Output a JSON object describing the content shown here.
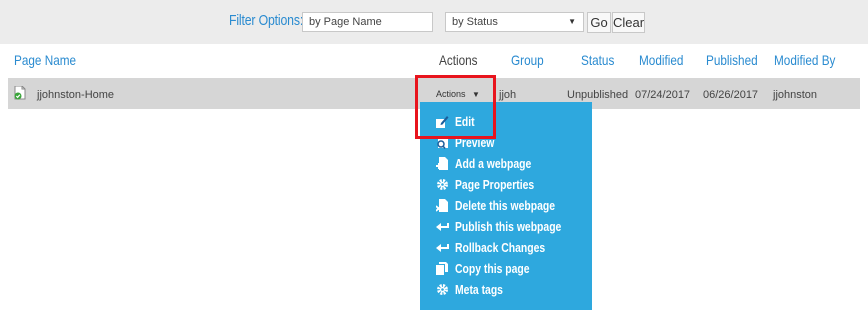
{
  "filter": {
    "label": "Filter Options:",
    "name_placeholder": "by Page Name",
    "status_select": "by Status",
    "go_label": "Go",
    "clear_label": "Clear"
  },
  "table": {
    "headers": {
      "page_name": "Page Name",
      "actions": "Actions",
      "group": "Group",
      "status": "Status",
      "modified": "Modified",
      "published": "Published",
      "modified_by": "Modified By"
    },
    "row": {
      "page_name": "jjohnston-Home",
      "actions": "Actions",
      "group": "jjoh",
      "status": "Unpublished",
      "modified": "07/24/2017",
      "published": "06/26/2017",
      "modified_by": "jjohnston"
    }
  },
  "menu": {
    "items": [
      {
        "label": "Edit",
        "icon": "edit-icon"
      },
      {
        "label": "Preview",
        "icon": "preview-icon"
      },
      {
        "label": "Add a webpage",
        "icon": "add-page-icon"
      },
      {
        "label": "Page Properties",
        "icon": "gear-icon"
      },
      {
        "label": "Delete this webpage",
        "icon": "delete-page-icon"
      },
      {
        "label": "Publish this webpage",
        "icon": "publish-arrow-icon"
      },
      {
        "label": "Rollback Changes",
        "icon": "rollback-arrow-icon"
      },
      {
        "label": "Copy this page",
        "icon": "copy-icon"
      },
      {
        "label": "Meta tags",
        "icon": "gear-icon"
      }
    ]
  },
  "colors": {
    "accent": "#2a8bd0",
    "menu_bg": "#2ea8de",
    "row_bg": "#d6d6d6",
    "filter_bg": "#ececec",
    "highlight": "#e8141d"
  }
}
